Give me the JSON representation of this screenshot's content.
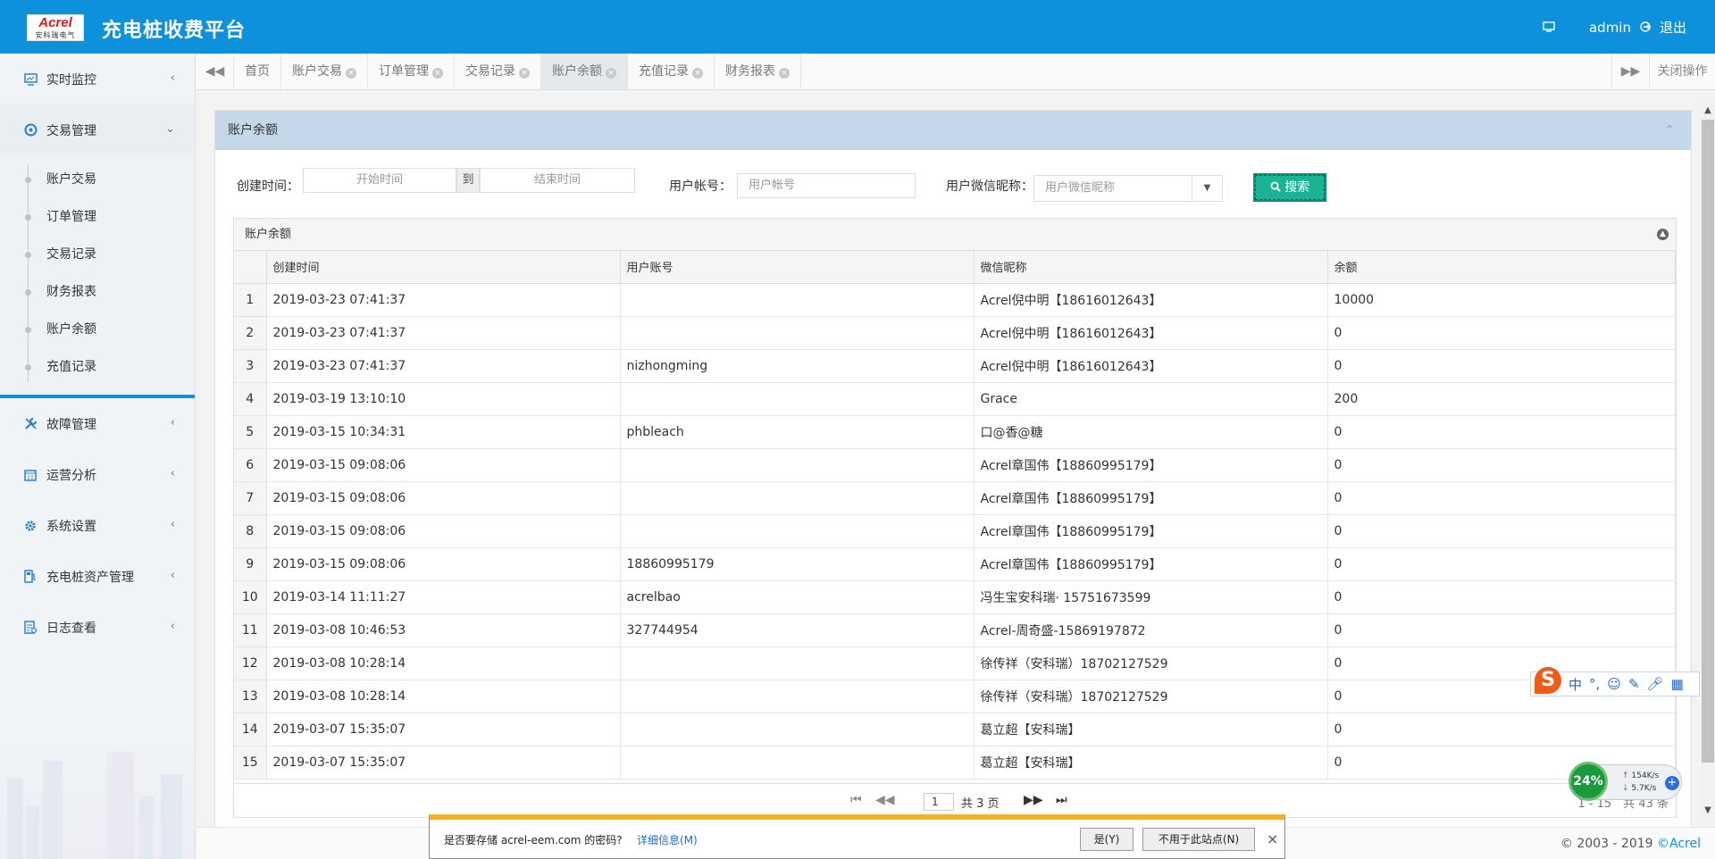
{
  "header": {
    "logo_text": "Acrel",
    "logo_sub": "安科瑞电气",
    "title": "充电桩收费平台",
    "user": "admin",
    "logout": "退出"
  },
  "sidebar": {
    "menus": [
      {
        "label": "实时监控",
        "icon": "monitor-icon"
      },
      {
        "label": "交易管理",
        "icon": "exchange-icon"
      },
      {
        "label": "故障管理",
        "icon": "wrench-icon"
      },
      {
        "label": "运营分析",
        "icon": "calendar-icon"
      },
      {
        "label": "系统设置",
        "icon": "gear-icon"
      },
      {
        "label": "充电桩资产管理",
        "icon": "charger-icon"
      },
      {
        "label": "日志查看",
        "icon": "log-icon"
      }
    ],
    "submenu": [
      "账户交易",
      "订单管理",
      "交易记录",
      "财务报表",
      "账户余额",
      "充值记录"
    ]
  },
  "tabbar": {
    "tabs": [
      {
        "label": "首页",
        "closable": false
      },
      {
        "label": "账户交易",
        "closable": true
      },
      {
        "label": "订单管理",
        "closable": true
      },
      {
        "label": "交易记录",
        "closable": true
      },
      {
        "label": "账户余额",
        "closable": true,
        "active": true
      },
      {
        "label": "充值记录",
        "closable": true
      },
      {
        "label": "财务报表",
        "closable": true
      }
    ],
    "close_ops": "关闭操作"
  },
  "panel": {
    "title": "账户余额"
  },
  "filter": {
    "create_time_label": "创建时间：",
    "start_placeholder": "开始时间",
    "to": "到",
    "end_placeholder": "结束时间",
    "account_label": "用户帐号：",
    "account_placeholder": "用户帐号",
    "nickname_label": "用户微信昵称：",
    "nickname_placeholder": "用户微信昵称",
    "search": "搜索"
  },
  "grid": {
    "caption": "账户余额",
    "columns": [
      "创建时间",
      "用户账号",
      "微信昵称",
      "余额"
    ],
    "rows": [
      [
        "1",
        "2019-03-23 07:41:37",
        "",
        "Acrel倪中明【18616012643】",
        "10000"
      ],
      [
        "2",
        "2019-03-23 07:41:37",
        "",
        "Acrel倪中明【18616012643】",
        "0"
      ],
      [
        "3",
        "2019-03-23 07:41:37",
        "nizhongming",
        "Acrel倪中明【18616012643】",
        "0"
      ],
      [
        "4",
        "2019-03-19 13:10:10",
        "",
        "Grace",
        "200"
      ],
      [
        "5",
        "2019-03-15 10:34:31",
        "phbleach",
        "口@香@糖",
        "0"
      ],
      [
        "6",
        "2019-03-15 09:08:06",
        "",
        "Acrel章国伟【18860995179】",
        "0"
      ],
      [
        "7",
        "2019-03-15 09:08:06",
        "",
        "Acrel章国伟【18860995179】",
        "0"
      ],
      [
        "8",
        "2019-03-15 09:08:06",
        "",
        "Acrel章国伟【18860995179】",
        "0"
      ],
      [
        "9",
        "2019-03-15 09:08:06",
        "18860995179",
        "Acrel章国伟【18860995179】",
        "0"
      ],
      [
        "10",
        "2019-03-14 11:11:27",
        "acrelbao",
        "冯生宝安科瑞· 15751673599",
        "0"
      ],
      [
        "11",
        "2019-03-08 10:46:53",
        "327744954",
        "Acrel-周奇盛-15869197872",
        "0"
      ],
      [
        "12",
        "2019-03-08 10:28:14",
        "",
        "徐传祥（安科瑞）18702127529",
        "0"
      ],
      [
        "13",
        "2019-03-08 10:28:14",
        "",
        "徐传祥（安科瑞）18702127529",
        "0"
      ],
      [
        "14",
        "2019-03-07 15:35:07",
        "",
        "葛立超【安科瑞】",
        "0"
      ],
      [
        "15",
        "2019-03-07 15:35:07",
        "",
        "葛立超【安科瑞】",
        "0"
      ]
    ]
  },
  "pager": {
    "page": "1",
    "total_pages": "共 3 页",
    "info": "1 - 15　共 43 条"
  },
  "footer": {
    "copyright": "© 2003 - 2019 ",
    "brand": "©Acrel"
  },
  "password_prompt": {
    "question": "是否要存储 acrel-eem.com 的密码?",
    "details": "详细信息(M)",
    "yes": "是(Y)",
    "never": "不用于此站点(N)"
  },
  "ime": {
    "lang": "中"
  },
  "net_widget": {
    "percent": "24%",
    "up": "154K/s",
    "down": "5.7K/s"
  }
}
